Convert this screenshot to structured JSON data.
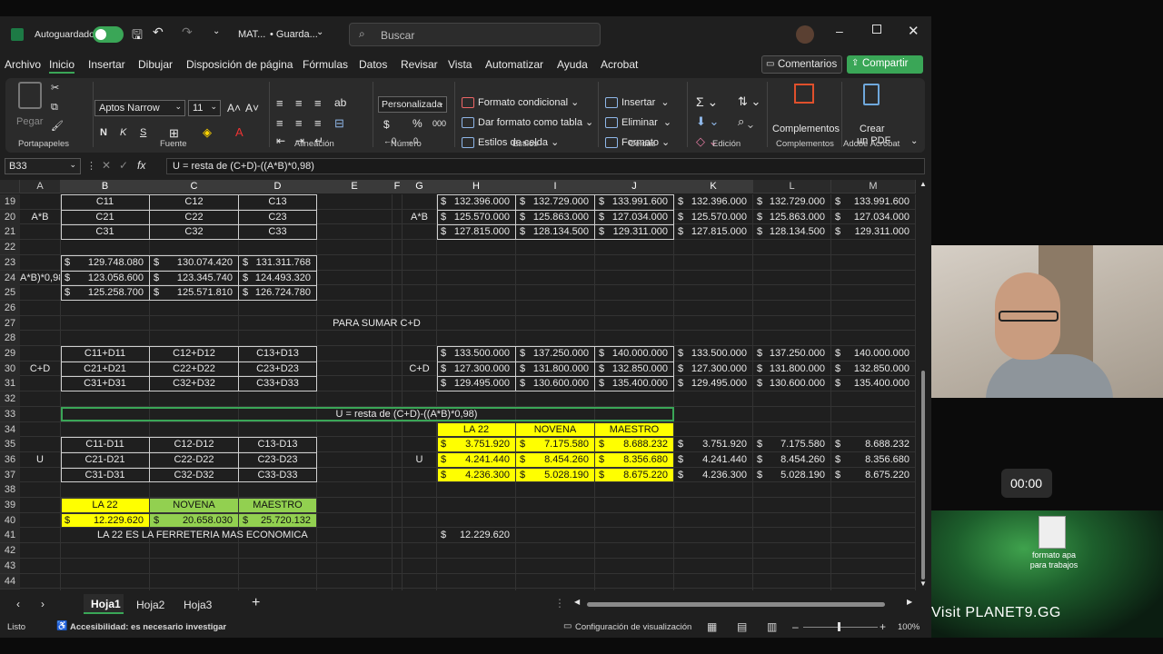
{
  "titlebar": {
    "autosave": "Autoguardado",
    "file": "MAT...",
    "status": "• Guarda...",
    "search_placeholder": "Buscar"
  },
  "menu": [
    "Archivo",
    "Inicio",
    "Insertar",
    "Dibujar",
    "Disposición de página",
    "Fórmulas",
    "Datos",
    "Revisar",
    "Vista",
    "Automatizar",
    "Ayuda",
    "Acrobat"
  ],
  "menu_right": {
    "comments": "Comentarios",
    "share": "Compartir"
  },
  "ribbon": {
    "paste": "Pegar",
    "font_name": "Aptos Narrow",
    "font_size": "11",
    "bold": "N",
    "italic": "K",
    "underline": "S",
    "number_format": "Personalizada",
    "currency": "$",
    "percent": "%",
    "thousands": "000",
    "cond_format": "Formato condicional",
    "table_format": "Dar formato como tabla",
    "cell_styles": "Estilos de celda",
    "insert": "Insertar",
    "delete": "Eliminar",
    "format": "Formato",
    "addins": "Complementos",
    "create_pdf": "Crear",
    "create_pdf2": "un PDF",
    "groups": {
      "clipboard": "Portapapeles",
      "font": "Fuente",
      "align": "Alineación",
      "number": "Número",
      "styles": "Estilos",
      "cells": "Celdas",
      "edit": "Edición",
      "addins": "Complementos",
      "acrobat": "Adobe Acrobat"
    }
  },
  "formula_bar": {
    "name_box": "B33",
    "fx": "fx",
    "formula": "U = resta de (C+D)-((A*B)*0,98)"
  },
  "columns": [
    "A",
    "B",
    "C",
    "D",
    "E",
    "F",
    "G",
    "H",
    "I",
    "J",
    "K",
    "L",
    "M"
  ],
  "rows": [
    "19",
    "20",
    "21",
    "22",
    "23",
    "24",
    "25",
    "26",
    "27",
    "28",
    "29",
    "30",
    "31",
    "32",
    "33",
    "34",
    "35",
    "36",
    "37",
    "38",
    "39",
    "40",
    "41",
    "42",
    "43",
    "44"
  ],
  "cells": {
    "A20": "A*B",
    "A24": "A*B)*0,98",
    "A30": "C+D",
    "A36": "U",
    "B19": "C11",
    "C19": "C12",
    "D19": "C13",
    "B20": "C21",
    "C20": "C22",
    "D20": "C23",
    "B21": "C31",
    "C21": "C32",
    "D21": "C33",
    "B23": "129.748.080",
    "C23": "130.074.420",
    "D23": "131.311.768",
    "B24": "123.058.600",
    "C24": "123.345.740",
    "D24": "124.493.320",
    "B25": "125.258.700",
    "C25": "125.571.810",
    "D25": "126.724.780",
    "E27": "PARA SUMAR C+D",
    "B29": "C11+D11",
    "C29": "C12+D12",
    "D29": "C13+D13",
    "B30": "C21+D21",
    "C30": "C22+D22",
    "D30": "C23+D23",
    "B31": "C31+D31",
    "C31": "C32+D32",
    "D31": "C33+D33",
    "B33": "U = resta de (C+D)-((A*B)*0,98)",
    "B35": "C11-D11",
    "C35": "C12-D12",
    "D35": "C13-D13",
    "B36": "C21-D21",
    "C36": "C22-D22",
    "D36": "C23-D23",
    "B37": "C31-D31",
    "C37": "C32-D32",
    "D37": "C33-D33",
    "B39": "LA 22",
    "C39": "NOVENA",
    "D39": "MAESTRO",
    "B40": "12.229.620",
    "C40": "20.658.030",
    "D40": "25.720.132",
    "B41": "LA 22 ES LA FERRETERIA MAS ECONOMICA",
    "G20": "A*B",
    "G30": "C+D",
    "G36": "U",
    "H19": "132.396.000",
    "I19": "132.729.000",
    "J19": "133.991.600",
    "K19": "132.396.000",
    "L19": "132.729.000",
    "M19": "133.991.600",
    "H20": "125.570.000",
    "I20": "125.863.000",
    "J20": "127.034.000",
    "K20": "125.570.000",
    "L20": "125.863.000",
    "M20": "127.034.000",
    "H21": "127.815.000",
    "I21": "128.134.500",
    "J21": "129.311.000",
    "K21": "127.815.000",
    "L21": "128.134.500",
    "M21": "129.311.000",
    "H29": "133.500.000",
    "I29": "137.250.000",
    "J29": "140.000.000",
    "K29": "133.500.000",
    "L29": "137.250.000",
    "M29": "140.000.000",
    "H30": "127.300.000",
    "I30": "131.800.000",
    "J30": "132.850.000",
    "K30": "127.300.000",
    "L30": "131.800.000",
    "M30": "132.850.000",
    "H31": "129.495.000",
    "I31": "130.600.000",
    "J31": "135.400.000",
    "K31": "129.495.000",
    "L31": "130.600.000",
    "M31": "135.400.000",
    "H34": "LA 22",
    "I34": "NOVENA",
    "J34": "MAESTRO",
    "H35": "3.751.920",
    "I35": "7.175.580",
    "J35": "8.688.232",
    "K35": "3.751.920",
    "L35": "7.175.580",
    "M35": "8.688.232",
    "H36": "4.241.440",
    "I36": "8.454.260",
    "J36": "8.356.680",
    "K36": "4.241.440",
    "L36": "8.454.260",
    "M36": "8.356.680",
    "H37": "4.236.300",
    "I37": "5.028.190",
    "J37": "8.675.220",
    "K37": "4.236.300",
    "L37": "5.028.190",
    "M37": "8.675.220",
    "H41": "12.229.620"
  },
  "currency_symbol": "$",
  "sheets": [
    "Hoja1",
    "Hoja2",
    "Hoja3"
  ],
  "status": {
    "ready": "Listo",
    "accessibility": "Accesibilidad: es necesario investigar",
    "view_settings": "Configuración de visualización",
    "zoom": "100%"
  },
  "overlay": {
    "timer": "00:00",
    "desktop_icon": "formato apa para trabajos",
    "watermark": "Visit PLANET9.GG"
  }
}
